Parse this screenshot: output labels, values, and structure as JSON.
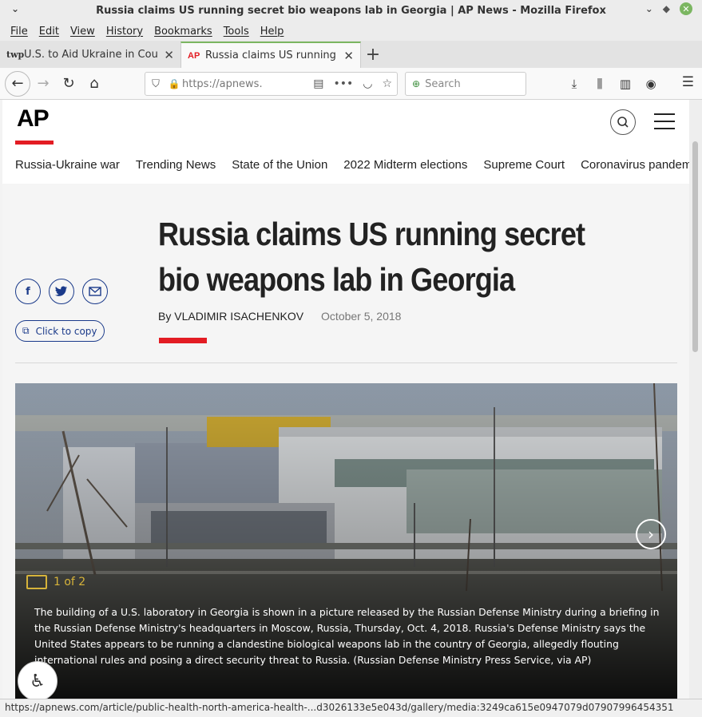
{
  "window": {
    "title": "Russia claims US running secret bio weapons lab in Georgia | AP News - Mozilla Firefox",
    "minimize_glyph": "⌄",
    "maximize_glyph": "⌃",
    "close_glyph": "✕"
  },
  "menu": [
    "File",
    "Edit",
    "View",
    "History",
    "Bookmarks",
    "Tools",
    "Help"
  ],
  "tabs": [
    {
      "favicon": "twp",
      "label": "U.S. to Aid Ukraine in Count",
      "active": false
    },
    {
      "favicon": "AP",
      "label": "Russia claims US running se",
      "active": true
    }
  ],
  "address_bar": {
    "url": "https://apnews.c",
    "search_placeholder": "Search"
  },
  "site": {
    "logo": "AP",
    "topics": [
      "Russia-Ukraine war",
      "Trending News",
      "State of the Union",
      "2022 Midterm elections",
      "Supreme Court",
      "Coronavirus pandemic"
    ]
  },
  "article": {
    "headline": "Russia claims US running secret bio weapons lab in Georgia",
    "byline": "By VLADIMIR ISACHENKOV",
    "date": "October 5, 2018",
    "copy_label": "Click to copy"
  },
  "gallery": {
    "counter": "1 of 2",
    "caption": "The building of a U.S. laboratory in Georgia is shown in a picture released by the Russian Defense Ministry during a briefing in the Russian Defense Ministry's headquarters in Moscow, Russia, Thursday, Oct. 4, 2018. Russia's Defense Ministry says the United States appears to be running a clandestine biological weapons lab in the country of Georgia, allegedly flouting international rules and posing a direct security threat to Russia. (Russian Defense Ministry Press Service, via AP)"
  },
  "status_bar": "https://apnews.com/article/public-health-north-america-health-...d3026133e5e043d/gallery/media:3249ca615e0947079d07907996454351",
  "colors": {
    "ap_red": "#e31c23",
    "social_blue": "#1a3a8a",
    "firefox_green": "#7bb661"
  }
}
